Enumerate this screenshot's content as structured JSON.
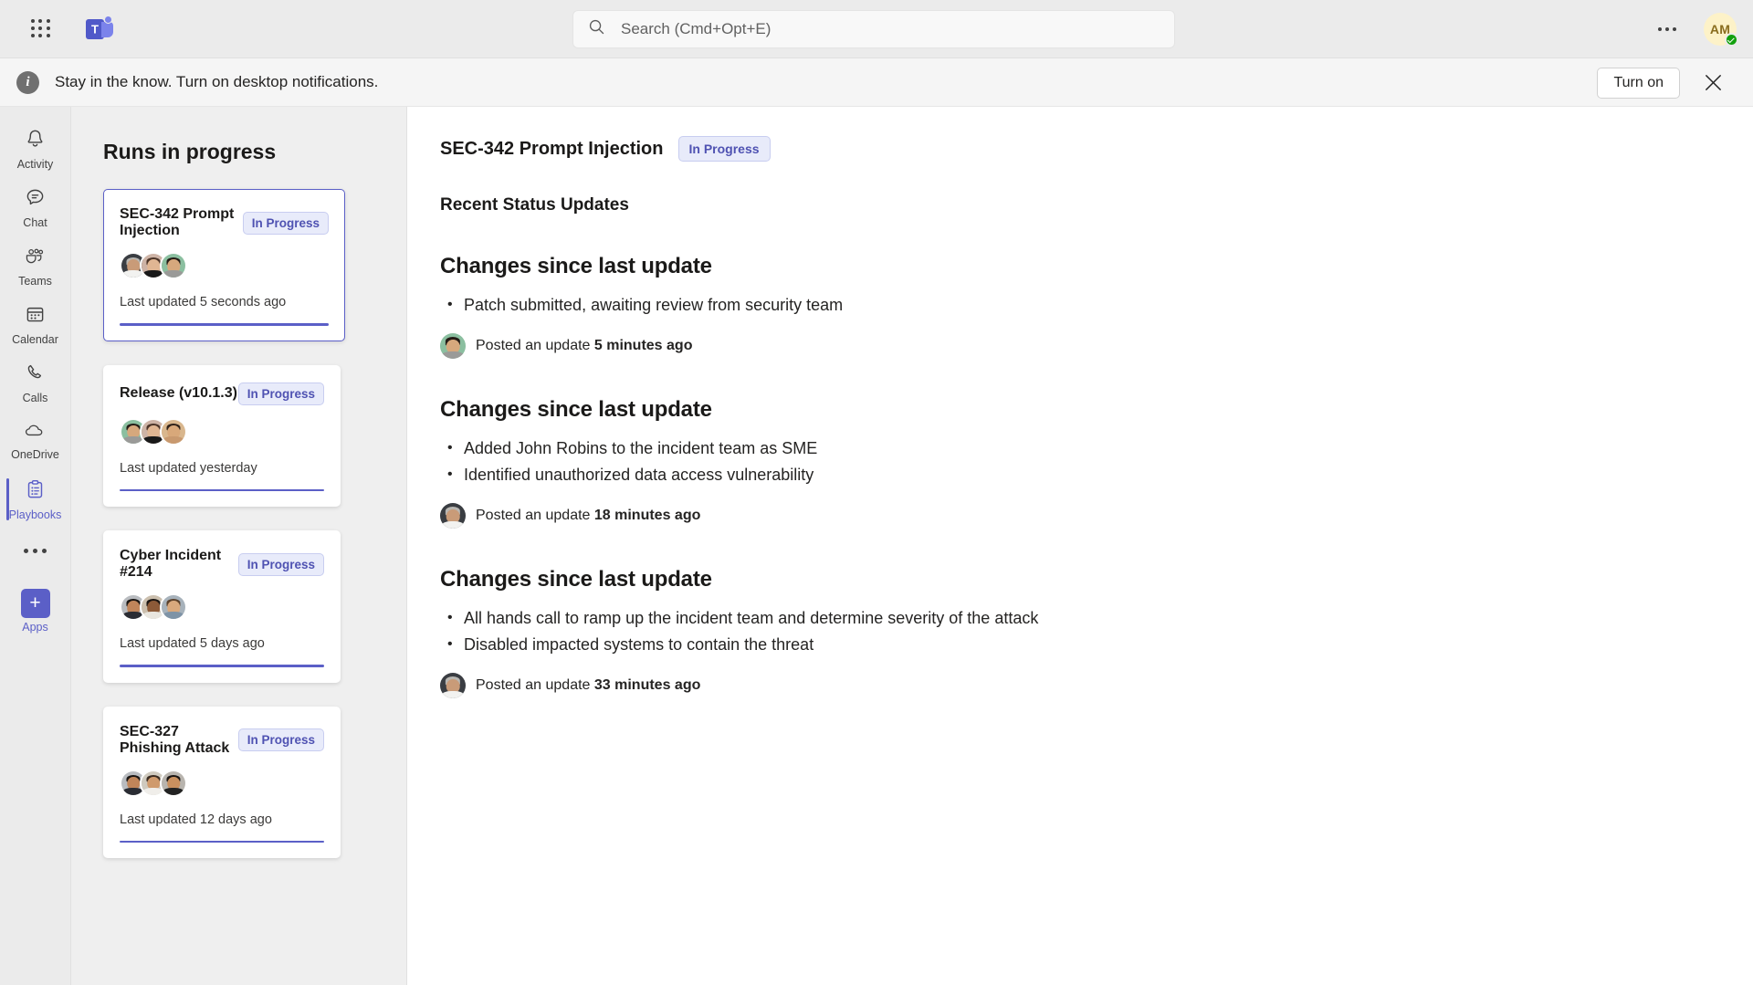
{
  "topbar": {
    "waffle_icon": "app-launcher-icon",
    "logo_icon": "teams-logo-icon",
    "search": {
      "icon": "search-icon",
      "placeholder": "Search (Cmd+Opt+E)",
      "value": ""
    },
    "more_icon": "ellipsis-icon",
    "avatar_initials": "AM",
    "presence_status": "available"
  },
  "banner": {
    "info_icon": "info-icon",
    "message": "Stay in the know. Turn on desktop notifications.",
    "turn_on_label": "Turn on",
    "close_icon": "close-icon"
  },
  "rail": {
    "items": [
      {
        "label": "Activity",
        "icon": "bell-icon",
        "active": false
      },
      {
        "label": "Chat",
        "icon": "chat-bubble-icon",
        "active": false
      },
      {
        "label": "Teams",
        "icon": "people-icon",
        "active": false
      },
      {
        "label": "Calendar",
        "icon": "calendar-icon",
        "active": false
      },
      {
        "label": "Calls",
        "icon": "phone-icon",
        "active": false
      },
      {
        "label": "OneDrive",
        "icon": "cloud-icon",
        "active": false
      },
      {
        "label": "Playbooks",
        "icon": "clipboard-icon",
        "active": true
      }
    ],
    "more_icon": "ellipsis-icon",
    "apps": {
      "label": "Apps",
      "icon": "plus-icon"
    }
  },
  "runs_panel": {
    "title": "Runs in progress",
    "cards": [
      {
        "title": "SEC-342 Prompt Injection",
        "status": "In Progress",
        "updated": "Last updated 5 seconds ago",
        "selected": true,
        "members": [
          "member-1",
          "member-2",
          "member-3"
        ]
      },
      {
        "title": "Release (v10.1.3)",
        "status": "In Progress",
        "updated": "Last updated yesterday",
        "selected": false,
        "members": [
          "member-3",
          "member-2",
          "member-4"
        ]
      },
      {
        "title": "Cyber Incident #214",
        "status": "In Progress",
        "updated": "Last updated 5 days ago",
        "selected": false,
        "members": [
          "member-5",
          "member-6",
          "member-7"
        ]
      },
      {
        "title": "SEC-327 Phishing Attack",
        "status": "In Progress",
        "updated": "Last updated 12 days ago",
        "selected": false,
        "members": [
          "member-5",
          "member-8",
          "member-9"
        ]
      }
    ]
  },
  "main": {
    "title": "SEC-342 Prompt Injection",
    "status": "In Progress",
    "section_heading": "Recent Status Updates",
    "updates": [
      {
        "heading": "Changes since last update",
        "bullets": [
          "Patch submitted, awaiting review from security team"
        ],
        "posted_prefix": "Posted an update ",
        "posted_time": "5 minutes ago",
        "author_avatar": "member-3"
      },
      {
        "heading": "Changes since last update",
        "bullets": [
          "Added John Robins to the incident team as SME",
          "Identified unauthorized data access vulnerability"
        ],
        "posted_prefix": "Posted an update ",
        "posted_time": "18 minutes ago",
        "author_avatar": "member-1"
      },
      {
        "heading": "Changes since last update",
        "bullets": [
          "All hands call to ramp up the incident team and determine severity of the attack",
          "Disabled impacted systems to contain the threat"
        ],
        "posted_prefix": "Posted an update ",
        "posted_time": "33 minutes ago",
        "author_avatar": "member-1"
      }
    ]
  },
  "colors": {
    "accent": "#5b5fc7",
    "badge_bg": "#e8ebfa",
    "badge_text": "#4f52b2",
    "chrome_bg": "#ebebeb",
    "panel_bg": "#efefef",
    "presence_green": "#13a10e"
  }
}
